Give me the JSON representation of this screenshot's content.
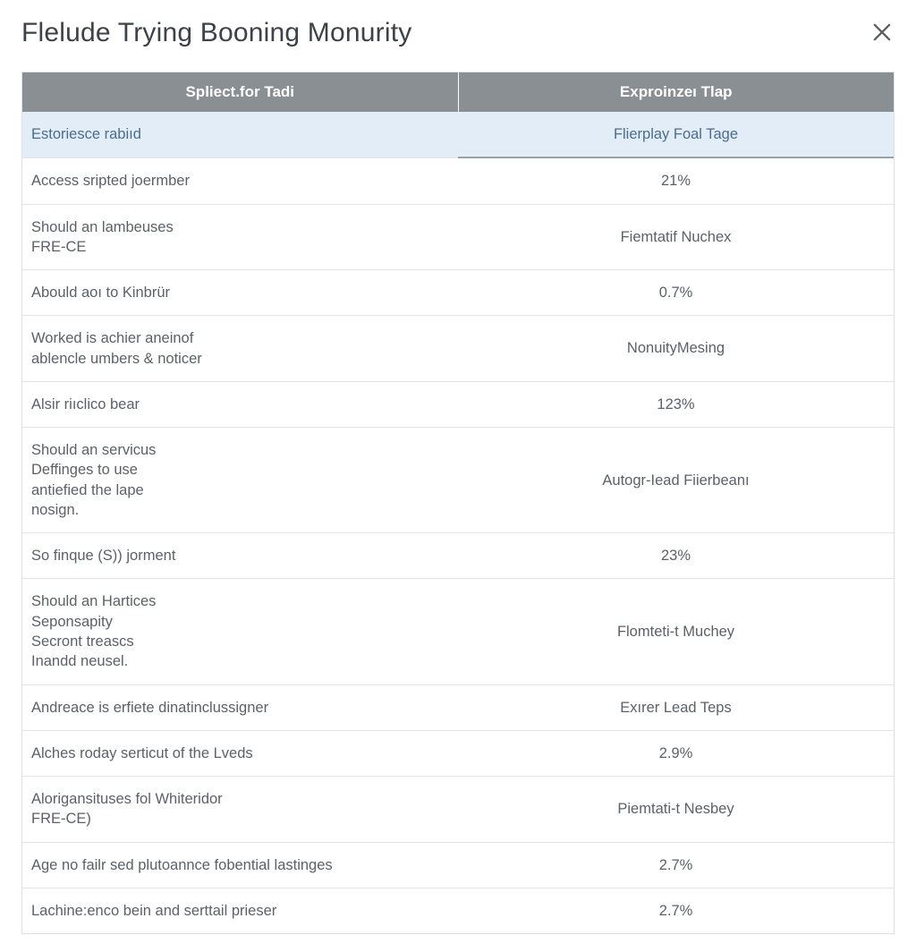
{
  "modal": {
    "title": "Flelude Trying Booning Monurity"
  },
  "table": {
    "headers": [
      "Spliect.for Tadi",
      "Exproinzeı Tlap"
    ],
    "rows": [
      {
        "left": "Estoriesce rabiıd",
        "right": "Flierplay Foal Tage",
        "highlight": true
      },
      {
        "left": "Access sripted joermber",
        "right": "21%"
      },
      {
        "left": "Should an lambeuses\nFRE-CE",
        "right": "Fiemtatif Nuchex"
      },
      {
        "left": "Abould aoı to Kinbrür",
        "right": "0.7%"
      },
      {
        "left": "Worked is achier aneinof\nablencle umbers & noticer",
        "right": "NonuityMesing"
      },
      {
        "left": "Alsir riıclico bear",
        "right": "123%"
      },
      {
        "left": "Should an servicus\nDeffinges to use\nantiefied the lape\nnosign.",
        "right": "Autogr-Iead Fiierbeanı"
      },
      {
        "left": "So finque (S)) jorment",
        "right": "23%"
      },
      {
        "left": "Should an Hartices\nSeponsapity\nSecront treascs\nInandd neusel.",
        "right": "Flomteti-t Muchey"
      },
      {
        "left": "Andreace is erfiete dinatinclussigner",
        "right": "Exırer Lead Teps"
      },
      {
        "left": "Alches roday serticut of the Lveds",
        "right": "2.9%"
      },
      {
        "left": "Alorigansituses fol Whiteridor\nFRE-CE)",
        "right": "Piemtati-t Nesbey"
      },
      {
        "left": "Age no failr sed plutoannce fobential lastinges",
        "right": "2.7%"
      },
      {
        "left": "Lachine:enco bein and serttail prieser",
        "right": "2.7%"
      }
    ]
  }
}
